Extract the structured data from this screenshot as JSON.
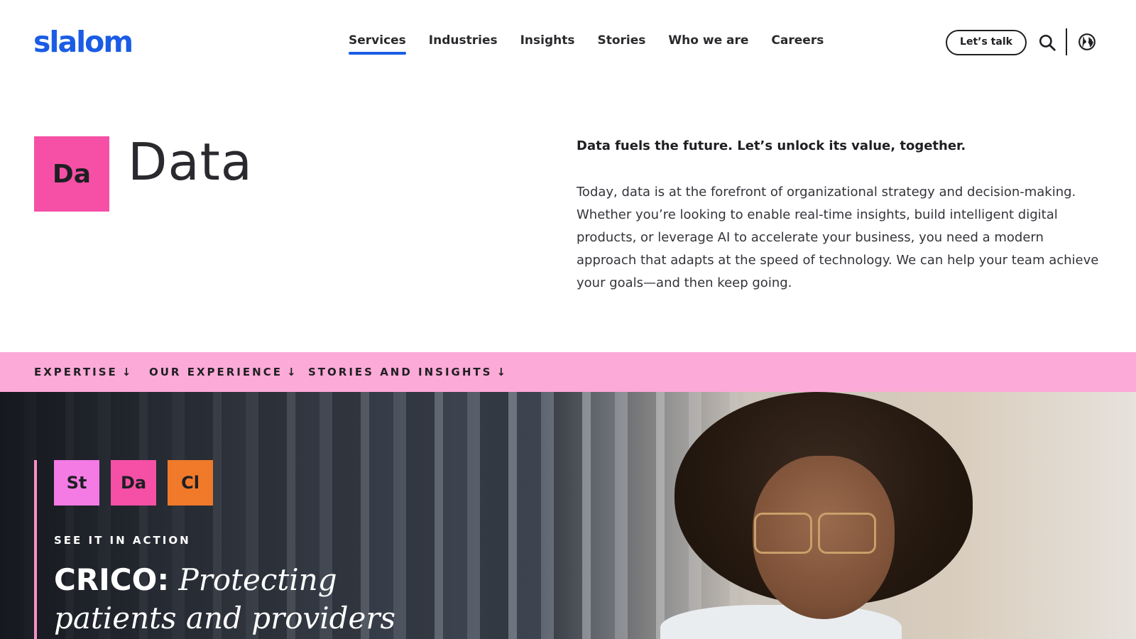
{
  "header": {
    "logo": "slalom",
    "nav": [
      {
        "label": "Services",
        "active": true
      },
      {
        "label": "Industries",
        "active": false
      },
      {
        "label": "Insights",
        "active": false
      },
      {
        "label": "Stories",
        "active": false
      },
      {
        "label": "Who we are",
        "active": false
      },
      {
        "label": "Careers",
        "active": false
      }
    ],
    "cta_label": "Let’s talk",
    "icons": {
      "search": "search-icon",
      "language": "globe-icon"
    }
  },
  "hero": {
    "tile_label": "Da",
    "title": "Data",
    "lead": "Data fuels the future. Let’s unlock its value, together.",
    "body": "Today, data is at the forefront of organizational strategy and decision-making. Whether you’re looking to enable real-time insights, build intelligent digital products, or leverage AI to accelerate your business, you need a modern approach that adapts at the speed of technology. We can help your team achieve your goals—and then keep going."
  },
  "anchors": [
    {
      "label": "EXPERTISE",
      "icon": "arrow-down-icon"
    },
    {
      "label": "OUR EXPERIENCE",
      "icon": "arrow-down-icon"
    },
    {
      "label": "STORIES AND INSIGHTS",
      "icon": "arrow-down-icon"
    }
  ],
  "feature": {
    "tags": [
      {
        "label": "St",
        "color": "#f47ae4"
      },
      {
        "label": "Da",
        "color": "#f550a5"
      },
      {
        "label": "Cl",
        "color": "#f07a2a"
      }
    ],
    "eyebrow": "SEE IT IN ACTION",
    "org": "CRICO:",
    "headline_rest": "Protecting patients and providers"
  },
  "colors": {
    "brand_blue": "#1a5ce5",
    "data_pink": "#f550a5",
    "anchor_bar": "#fcaad7"
  }
}
